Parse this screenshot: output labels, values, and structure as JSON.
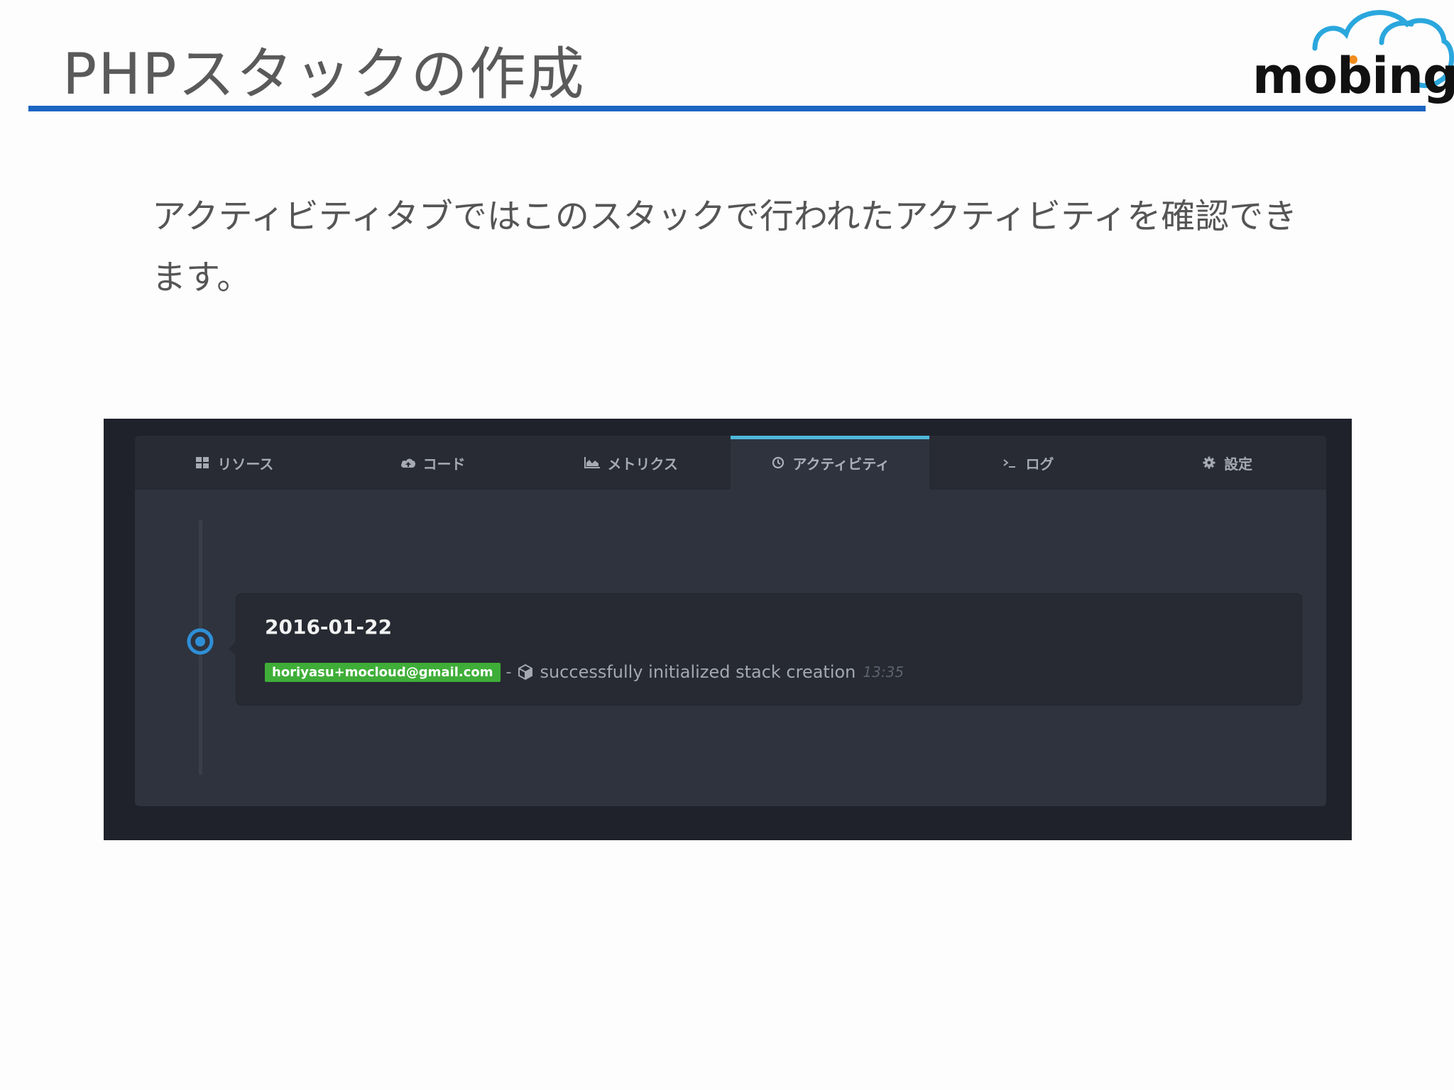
{
  "slide": {
    "title": "PHPスタックの作成",
    "description": "アクティビティタブではこのスタックで行われたアクティビティを確認できます。",
    "logo_text": "mobingi"
  },
  "tabs": [
    {
      "label": "リソース",
      "icon": "grid-icon",
      "active": false
    },
    {
      "label": "コード",
      "icon": "cloud-upload-icon",
      "active": false
    },
    {
      "label": "メトリクス",
      "icon": "area-chart-icon",
      "active": false
    },
    {
      "label": "アクティビティ",
      "icon": "clock-icon",
      "active": true
    },
    {
      "label": "ログ",
      "icon": "terminal-icon",
      "active": false
    },
    {
      "label": "設定",
      "icon": "gear-icon",
      "active": false
    }
  ],
  "activity": {
    "date": "2016-01-22",
    "user": "horiyasu+mocloud@gmail.com",
    "separator": "-",
    "icon": "cube-icon",
    "message": "successfully initialized stack creation",
    "time": "13:35"
  },
  "colors": {
    "title_rule": "#1a64c2",
    "tab_active_indicator": "#4fb8da",
    "user_badge": "#3fae38",
    "timeline_dot": "#2f8fd6",
    "screen_bg": "#1f222a",
    "panel_bg": "#2f333d"
  }
}
